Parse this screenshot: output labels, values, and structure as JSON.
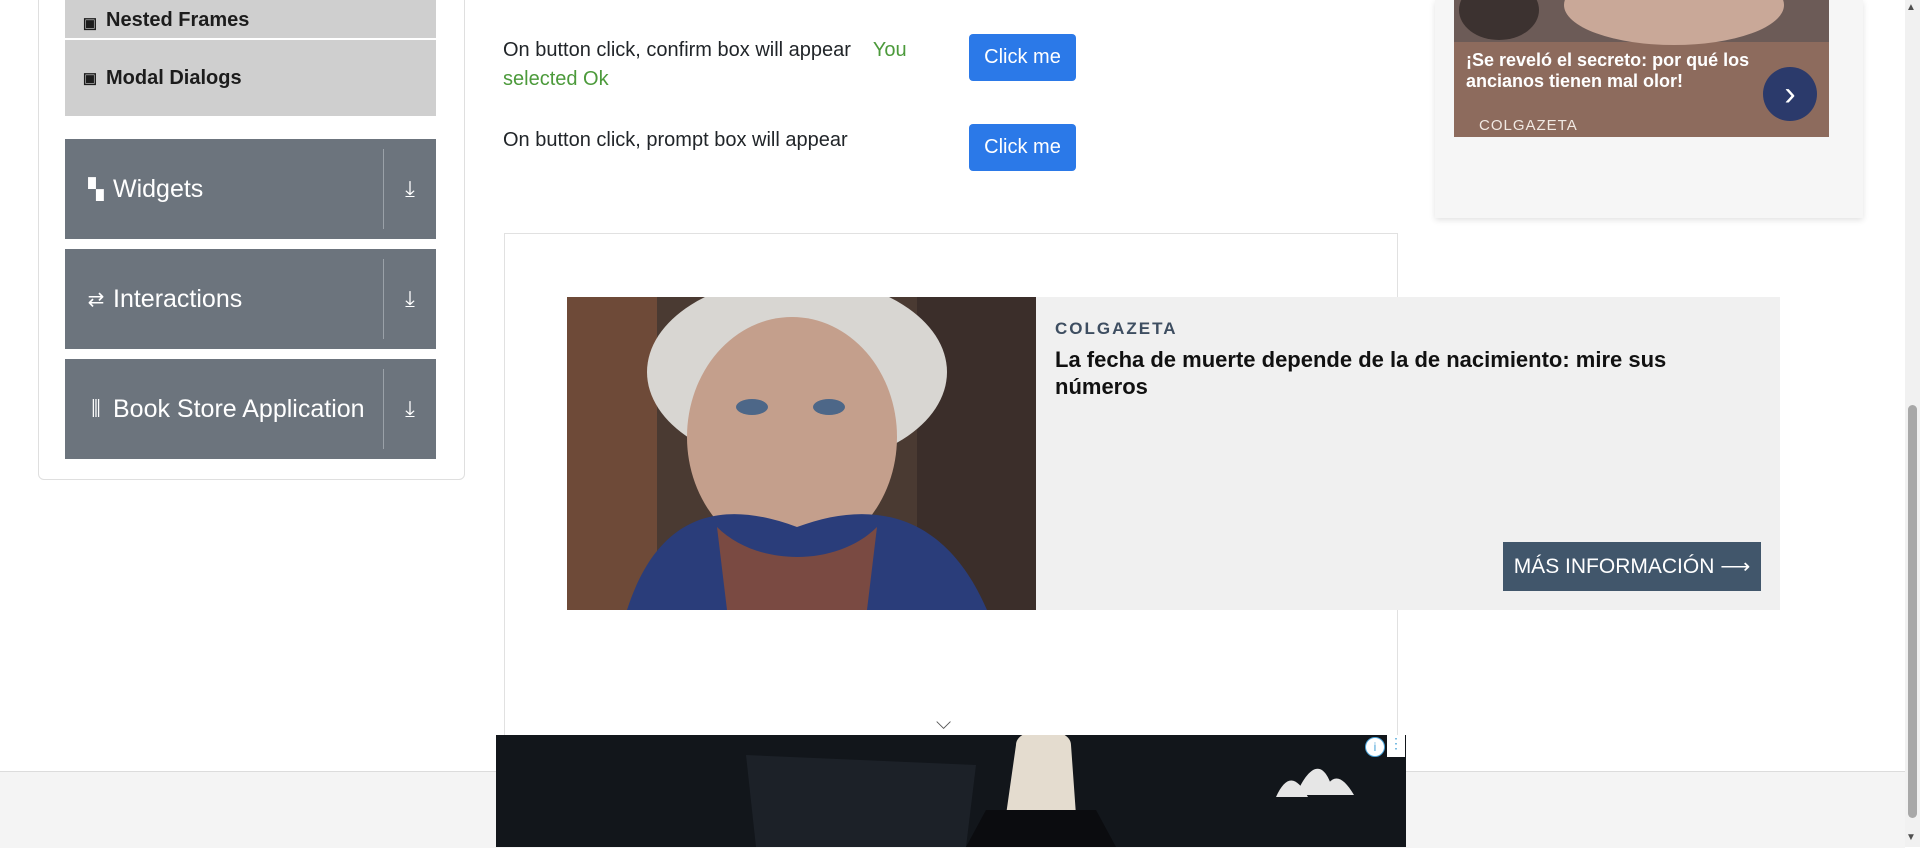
{
  "sidebar": {
    "sub_items": [
      {
        "label": "Nested Frames",
        "icon": "html5-icon"
      },
      {
        "label": "Modal Dialogs",
        "icon": "html5-icon"
      }
    ],
    "groups": [
      {
        "label": "Widgets",
        "icon": "widgets-icon"
      },
      {
        "label": "Interactions",
        "icon": "interactions-icon"
      },
      {
        "label": "Book Store Application",
        "icon": "books-icon"
      }
    ]
  },
  "alerts": {
    "confirm": {
      "text": "On button click, confirm box will appear",
      "result": "You selected Ok",
      "button": "Click me"
    },
    "prompt": {
      "text": "On button click, prompt box will appear",
      "button": "Click me"
    }
  },
  "ad_main": {
    "source": "COLGAZETA",
    "headline": "La fecha de muerte depende de la de nacimiento: mire sus números",
    "cta": "MÁS INFORMACIÓN ⟶"
  },
  "ad_right": {
    "text": "¡Se reveló el secreto: por qué los ancianos tienen mal olor!",
    "source": "COLGAZETA"
  },
  "colors": {
    "primary_button": "#2b79e8",
    "sidebar_group": "#6c747d",
    "success_text": "#4c9a3b"
  }
}
